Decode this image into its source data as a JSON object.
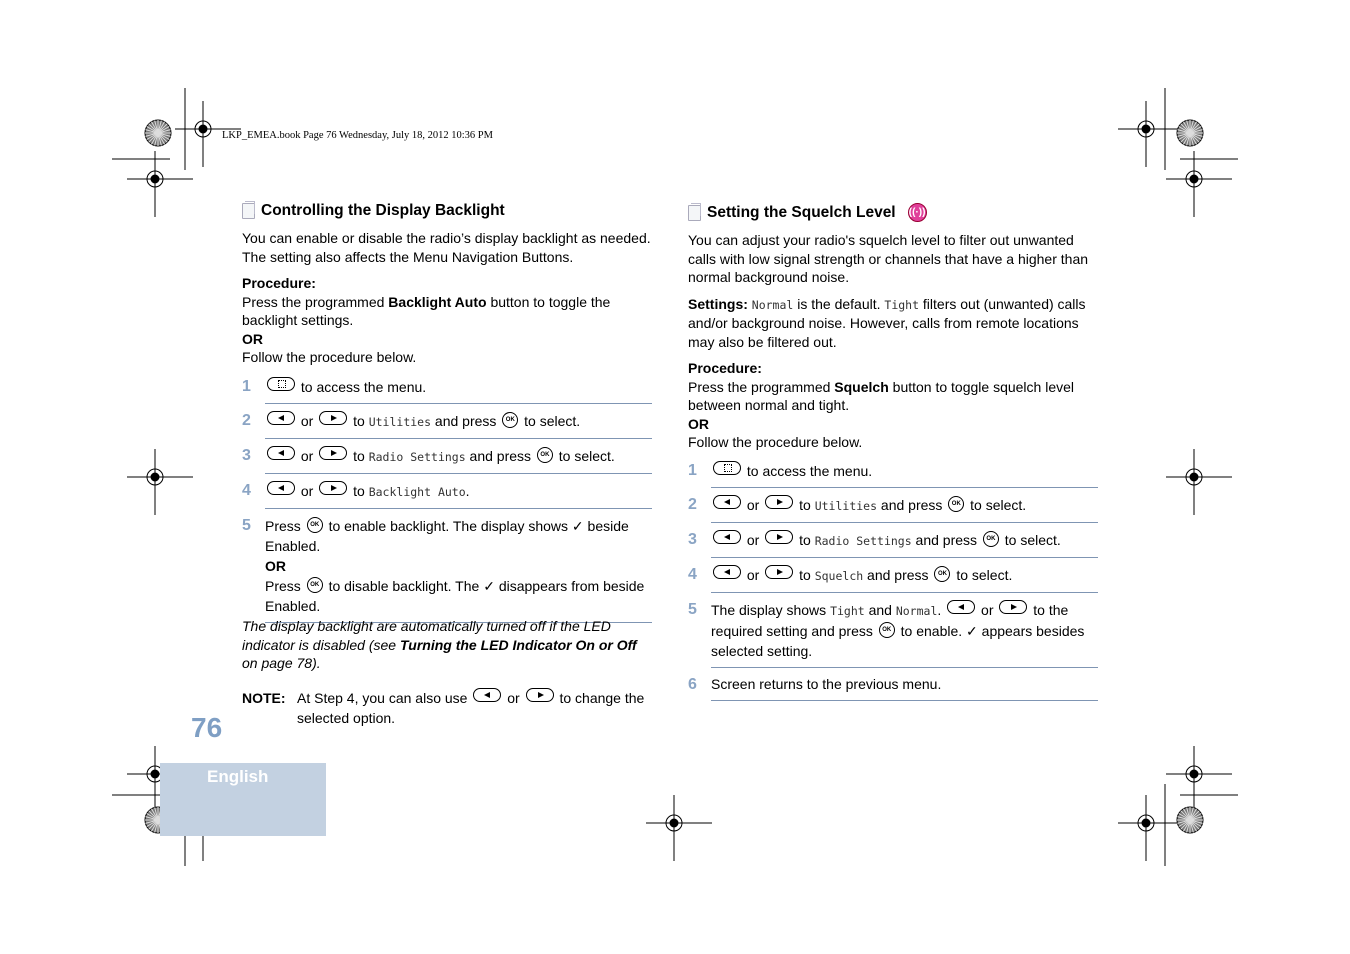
{
  "print_header": "LKP_EMEA.book  Page 76  Wednesday, July 18, 2012  10:36 PM",
  "page_number": "76",
  "language_tab": "English",
  "colors": {
    "accent": "#7f9fc4",
    "tab": "#c3d1e1",
    "rule": "#7f95b3",
    "squelch_icon": "#e0409a"
  },
  "left": {
    "title": "Controlling the Display Backlight",
    "blocks": [
      [
        {
          "t": "You can enable or disable the radio’s display backlight as needed. The setting also affects the Menu Navigation Buttons."
        }
      ],
      [
        {
          "b": "Procedure:"
        }
      ],
      [
        {
          "t": "Press the programmed "
        },
        {
          "b": "Backlight Auto"
        },
        {
          "t": " button to toggle the backlight settings."
        }
      ],
      [
        {
          "b": "OR"
        }
      ],
      [
        {
          "t": "Follow the procedure below."
        }
      ]
    ],
    "steps": [
      {
        "n": "1",
        "seg": [
          {
            "key": "menu"
          },
          {
            "t": " to access the menu."
          }
        ]
      },
      {
        "n": "2",
        "seg": [
          {
            "key": "left"
          },
          {
            "t": " or "
          },
          {
            "key": "right"
          },
          {
            "t": " to "
          },
          {
            "m": "Utilities"
          },
          {
            "t": " and press "
          },
          {
            "key": "ok"
          },
          {
            "t": " to select."
          }
        ]
      },
      {
        "n": "3",
        "seg": [
          {
            "key": "left"
          },
          {
            "t": " or "
          },
          {
            "key": "right"
          },
          {
            "t": " to "
          },
          {
            "m": "Radio Settings"
          },
          {
            "t": " and press "
          },
          {
            "key": "ok"
          },
          {
            "t": " to select."
          }
        ]
      },
      {
        "n": "4",
        "seg": [
          {
            "key": "left"
          },
          {
            "t": " or "
          },
          {
            "key": "right"
          },
          {
            "t": " to "
          },
          {
            "m": "Backlight Auto"
          },
          {
            "t": "."
          }
        ]
      },
      {
        "n": "5",
        "seg": [
          {
            "t": "Press "
          },
          {
            "key": "ok"
          },
          {
            "t": " to enable backlight. The display shows ✓ beside Enabled."
          },
          {
            "br": true
          },
          {
            "b": "OR"
          },
          {
            "br": true
          },
          {
            "t": "Press "
          },
          {
            "key": "ok"
          },
          {
            "t": " to disable backlight. The ✓ disappears from beside Enabled."
          }
        ]
      }
    ],
    "italic_note": [
      {
        "i": "The display backlight are automatically turned off if the LED indicator is disabled (see "
      },
      {
        "bi": "Turning the LED Indicator On or Off"
      },
      {
        "i": " on page 78)."
      }
    ],
    "note_label": "NOTE:",
    "note": [
      {
        "t": "At Step 4, you can also use "
      },
      {
        "key": "left"
      },
      {
        "t": " or "
      },
      {
        "key": "right"
      },
      {
        "t": " to change the selected option."
      }
    ]
  },
  "right": {
    "title": "Setting the Squelch Level",
    "blocks": [
      [
        {
          "t": "You can adjust your radio's squelch level to filter out unwanted calls with low signal strength or channels that have a higher than normal background noise."
        }
      ],
      [
        {
          "b": "Settings: "
        },
        {
          "m": "Normal"
        },
        {
          "t": " is the default. "
        },
        {
          "m": "Tight"
        },
        {
          "t": " filters out (unwanted) calls and/or background noise. However, calls from remote locations may also be filtered out."
        }
      ],
      [
        {
          "b": "Procedure:"
        }
      ],
      [
        {
          "t": "Press the programmed "
        },
        {
          "b": "Squelch"
        },
        {
          "t": " button to toggle squelch level between normal and tight."
        }
      ],
      [
        {
          "b": "OR"
        }
      ],
      [
        {
          "t": "Follow the procedure below."
        }
      ]
    ],
    "steps": [
      {
        "n": "1",
        "seg": [
          {
            "key": "menu"
          },
          {
            "t": " to access the menu."
          }
        ]
      },
      {
        "n": "2",
        "seg": [
          {
            "key": "left"
          },
          {
            "t": " or "
          },
          {
            "key": "right"
          },
          {
            "t": " to "
          },
          {
            "m": "Utilities"
          },
          {
            "t": " and press "
          },
          {
            "key": "ok"
          },
          {
            "t": " to select."
          }
        ]
      },
      {
        "n": "3",
        "seg": [
          {
            "key": "left"
          },
          {
            "t": " or "
          },
          {
            "key": "right"
          },
          {
            "t": " to "
          },
          {
            "m": "Radio Settings"
          },
          {
            "t": " and press "
          },
          {
            "key": "ok"
          },
          {
            "t": " to select."
          }
        ]
      },
      {
        "n": "4",
        "seg": [
          {
            "key": "left"
          },
          {
            "t": " or "
          },
          {
            "key": "right"
          },
          {
            "t": " to "
          },
          {
            "m": "Squelch"
          },
          {
            "t": " and press "
          },
          {
            "key": "ok"
          },
          {
            "t": " to select."
          }
        ]
      },
      {
        "n": "5",
        "seg": [
          {
            "t": "The display shows "
          },
          {
            "m": "Tight"
          },
          {
            "t": " and "
          },
          {
            "m": "Normal"
          },
          {
            "t": ". "
          },
          {
            "key": "left"
          },
          {
            "t": " or "
          },
          {
            "key": "right"
          },
          {
            "t": " to the required setting and press "
          },
          {
            "key": "ok"
          },
          {
            "t": " to enable. ✓ appears besides selected setting."
          }
        ]
      },
      {
        "n": "6",
        "seg": [
          {
            "t": "Screen returns to the previous menu."
          }
        ]
      }
    ]
  }
}
